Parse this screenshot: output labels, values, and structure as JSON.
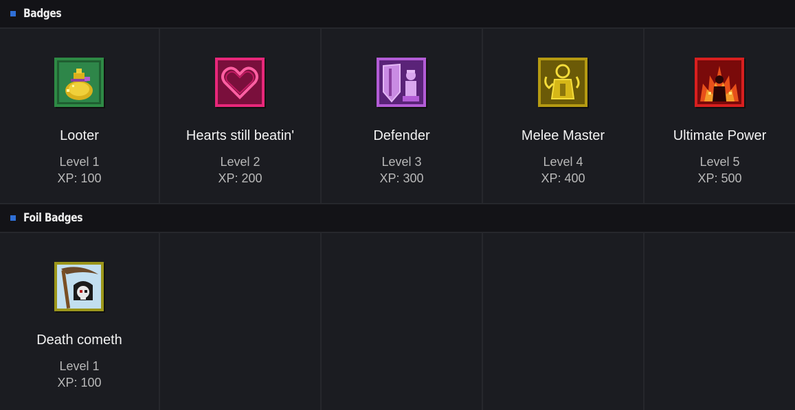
{
  "sections": [
    {
      "title": "Badges",
      "badges": [
        {
          "name": "Looter",
          "level": "Level 1",
          "xp": "XP: 100",
          "icon": "loot-bag-icon",
          "color": "#3aa85c"
        },
        {
          "name": "Hearts still beatin'",
          "level": "Level 2",
          "xp": "XP: 200",
          "icon": "heart-icon",
          "color": "#e8277a"
        },
        {
          "name": "Defender",
          "level": "Level 3",
          "xp": "XP: 300",
          "icon": "shield-knight-icon",
          "color": "#b35cd6"
        },
        {
          "name": "Melee Master",
          "level": "Level 4",
          "xp": "XP: 400",
          "icon": "fist-warrior-icon",
          "color": "#d6b718"
        },
        {
          "name": "Ultimate Power",
          "level": "Level 5",
          "xp": "XP: 500",
          "icon": "fire-power-icon",
          "color": "#e02b2b"
        }
      ]
    },
    {
      "title": "Foil Badges",
      "badges": [
        {
          "name": "Death cometh",
          "level": "Level 1",
          "xp": "XP: 100",
          "icon": "skull-scythe-icon",
          "color": "#b8b21c"
        }
      ]
    }
  ],
  "colors": {
    "accent": "#2f6fd6",
    "background": "#1b1c21",
    "header_background": "#131317"
  }
}
